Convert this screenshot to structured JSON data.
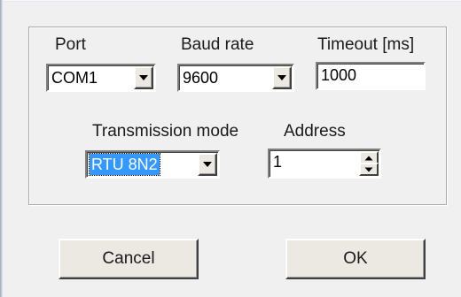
{
  "port": {
    "label": "Port",
    "value": "COM1",
    "dropdown_icon": "chevron-down-icon"
  },
  "baud_rate": {
    "label": "Baud rate",
    "value": "9600",
    "dropdown_icon": "chevron-down-icon"
  },
  "timeout": {
    "label": "Timeout [ms]",
    "value": "1000"
  },
  "transmission_mode": {
    "label": "Transmission mode",
    "value": "RTU 8N2",
    "dropdown_icon": "chevron-down-icon",
    "selected_color": "#3399ff"
  },
  "address": {
    "label": "Address",
    "value": "1",
    "spin_up_icon": "arrow-up-icon",
    "spin_down_icon": "arrow-down-icon"
  },
  "buttons": {
    "cancel": "Cancel",
    "ok": "OK"
  }
}
